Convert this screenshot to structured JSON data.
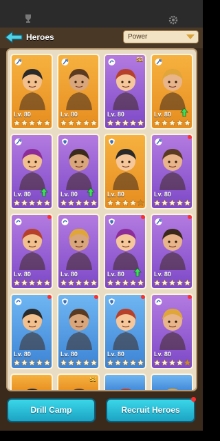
{
  "header": {
    "title": "Heroes",
    "sort_label": "Power"
  },
  "colors": {
    "gold": "#f6b13f",
    "purple": "#9a62d8",
    "blue": "#5a9fe6",
    "button": "#2bbfd8",
    "badge_dot": "#ff2e2e"
  },
  "heroes": [
    {
      "level": "Lv. 80",
      "theme": "gold",
      "class_icon": "axe-icon",
      "stars": 5,
      "upgrade": false,
      "notify": false,
      "s3": ""
    },
    {
      "level": "Lv. 80",
      "theme": "gold",
      "class_icon": "axe-icon",
      "stars": 5,
      "upgrade": false,
      "notify": false,
      "s3": ""
    },
    {
      "level": "Lv. 80",
      "theme": "purple",
      "class_icon": "swirl-icon",
      "stars": 5,
      "upgrade": false,
      "notify": false,
      "s3": "S3"
    },
    {
      "level": "Lv. 80",
      "theme": "gold",
      "class_icon": "axe-icon",
      "stars": 5,
      "upgrade": true,
      "notify": false,
      "s3": ""
    },
    {
      "level": "Lv. 80",
      "theme": "purple",
      "class_icon": "axe-icon",
      "stars": 5,
      "upgrade": true,
      "notify": false,
      "s3": ""
    },
    {
      "level": "Lv. 80",
      "theme": "purple",
      "class_icon": "shield-icon",
      "stars": 5,
      "upgrade": true,
      "notify": false,
      "s3": ""
    },
    {
      "level": "Lv. 80",
      "theme": "gold",
      "class_icon": "shield-icon",
      "stars": 4,
      "upgrade": false,
      "notify": false,
      "s3": ""
    },
    {
      "level": "Lv. 80",
      "theme": "purple",
      "class_icon": "axe-icon",
      "stars": 5,
      "upgrade": false,
      "notify": true,
      "s3": ""
    },
    {
      "level": "Lv. 80",
      "theme": "purple",
      "class_icon": "swirl-icon",
      "stars": 5,
      "upgrade": false,
      "notify": true,
      "s3": ""
    },
    {
      "level": "Lv. 80",
      "theme": "purple",
      "class_icon": "swirl-icon",
      "stars": 5,
      "upgrade": false,
      "notify": false,
      "s3": ""
    },
    {
      "level": "Lv. 80",
      "theme": "purple",
      "class_icon": "shield-icon",
      "stars": 5,
      "upgrade": true,
      "notify": true,
      "s3": ""
    },
    {
      "level": "Lv. 80",
      "theme": "purple",
      "class_icon": "axe-icon",
      "stars": 5,
      "upgrade": false,
      "notify": true,
      "s3": ""
    },
    {
      "level": "Lv. 80",
      "theme": "blue",
      "class_icon": "swirl-icon",
      "stars": 5,
      "upgrade": false,
      "notify": true,
      "s3": ""
    },
    {
      "level": "Lv. 80",
      "theme": "blue",
      "class_icon": "shield-icon",
      "stars": 5,
      "upgrade": false,
      "notify": true,
      "s3": ""
    },
    {
      "level": "Lv. 80",
      "theme": "blue",
      "class_icon": "shield-icon",
      "stars": 5,
      "upgrade": false,
      "notify": true,
      "s3": ""
    },
    {
      "level": "Lv. 80",
      "theme": "purple",
      "class_icon": "swirl-icon",
      "stars": 4,
      "upgrade": false,
      "notify": true,
      "s3": ""
    }
  ],
  "partial_row": [
    {
      "theme": "gold",
      "s3": ""
    },
    {
      "theme": "gold",
      "s3": "S3"
    },
    {
      "theme": "blue",
      "s3": ""
    },
    {
      "theme": "blue",
      "s3": ""
    }
  ],
  "buttons": {
    "drill_camp": "Drill Camp",
    "recruit_heroes": "Recruit Heroes"
  }
}
